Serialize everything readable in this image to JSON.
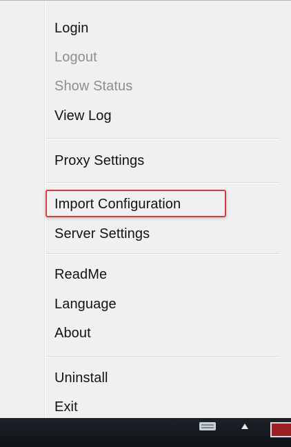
{
  "menu": {
    "items": [
      {
        "label": "Login",
        "enabled": true
      },
      {
        "label": "Logout",
        "enabled": false
      },
      {
        "label": "Show Status",
        "enabled": false
      },
      {
        "label": "View Log",
        "enabled": true
      },
      {
        "label": "Proxy Settings",
        "enabled": true
      },
      {
        "label": "Import Configuration",
        "enabled": true,
        "highlighted": true
      },
      {
        "label": "Server Settings",
        "enabled": true
      },
      {
        "label": "ReadMe",
        "enabled": true
      },
      {
        "label": "Language",
        "enabled": true
      },
      {
        "label": "About",
        "enabled": true
      },
      {
        "label": "Uninstall",
        "enabled": true
      },
      {
        "label": "Exit",
        "enabled": true
      }
    ]
  },
  "colors": {
    "menu_background": "#f0f0f0",
    "enabled_text": "#121212",
    "disabled_text": "#8e8e8e",
    "highlight_border": "#d63a3a",
    "taskbar": "#151a1f"
  },
  "icons": {
    "tray": [
      "keyboard-icon",
      "show-hidden-icons-arrow-icon",
      "app-tray-icon"
    ]
  }
}
